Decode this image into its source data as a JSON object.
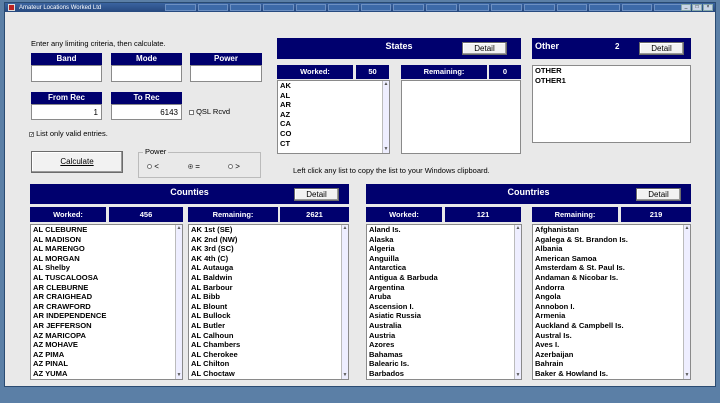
{
  "window": {
    "title": "Amateur Locations Worked Ltd"
  },
  "instructions": "Enter any limiting criteria, then calculate.",
  "filters": {
    "band_label": "Band",
    "mode_label": "Mode",
    "power_label": "Power",
    "band_value": "",
    "mode_value": "",
    "power_value": "",
    "from_rec_label": "From Rec",
    "to_rec_label": "To Rec",
    "from_rec_value": "1",
    "to_rec_value": "6143",
    "qsl_rcvd_label": "QSL Rcvd",
    "valid_only_label": "List only valid entries."
  },
  "calculate_label": "Calculate",
  "power_group": {
    "label": "Power",
    "options": [
      "<",
      "=",
      ">"
    ],
    "selected": "="
  },
  "clipboard_hint": "Left click any list to copy the list to your Windows clipboard.",
  "states": {
    "title": "States",
    "detail_label": "Detail",
    "worked_label": "Worked:",
    "worked_count": "50",
    "remaining_label": "Remaining:",
    "remaining_count": "0",
    "worked": [
      "AK",
      "AL",
      "AR",
      "AZ",
      "CA",
      "CO",
      "CT"
    ],
    "remaining": []
  },
  "other": {
    "title": "Other",
    "count": "2",
    "detail_label": "Detail",
    "items": [
      "OTHER",
      "OTHER1"
    ]
  },
  "counties": {
    "title": "Counties",
    "detail_label": "Detail",
    "worked_label": "Worked:",
    "worked_count": "456",
    "remaining_label": "Remaining:",
    "remaining_count": "2621",
    "worked": [
      "AL  CLEBURNE",
      "AL  MADISON",
      "AL  MARENGO",
      "AL  MORGAN",
      "AL  Shelby",
      "AL  TUSCALOOSA",
      "AR  CLEBURNE",
      "AR  CRAIGHEAD",
      "AR  CRAWFORD",
      "AR  INDEPENDENCE",
      "AR  JEFFERSON",
      "AZ  MARICOPA",
      "AZ  MOHAVE",
      "AZ  PIMA",
      "AZ  PINAL",
      "AZ  YUMA"
    ],
    "remaining": [
      "AK  1st (SE)",
      "AK  2nd (NW)",
      "AK  3rd (SC)",
      "AK  4th (C)",
      "AL  Autauga",
      "AL  Baldwin",
      "AL  Barbour",
      "AL  Bibb",
      "AL  Blount",
      "AL  Bullock",
      "AL  Butler",
      "AL  Calhoun",
      "AL  Chambers",
      "AL  Cherokee",
      "AL  Chilton",
      "AL  Choctaw"
    ]
  },
  "countries": {
    "title": "Countries",
    "detail_label": "Detail",
    "worked_label": "Worked:",
    "worked_count": "121",
    "remaining_label": "Remaining:",
    "remaining_count": "219",
    "worked": [
      "Aland Is.",
      "Alaska",
      "Algeria",
      "Anguilla",
      "Antarctica",
      "Antigua & Barbuda",
      "Argentina",
      "Aruba",
      "Ascension I.",
      "Asiatic Russia",
      "Australia",
      "Austria",
      "Azores",
      "Bahamas",
      "Balearic Is.",
      "Barbados"
    ],
    "remaining": [
      "Afghanistan",
      "Agalega & St. Brandon Is.",
      "Albania",
      "American Samoa",
      "Amsterdam & St. Paul Is.",
      "Andaman & Nicobar Is.",
      "Andorra",
      "Angola",
      "Annobon I.",
      "Armenia",
      "Auckland & Campbell Is.",
      "Austral Is.",
      "Aves I.",
      "Azerbaijan",
      "Bahrain",
      "Baker & Howland Is."
    ]
  }
}
